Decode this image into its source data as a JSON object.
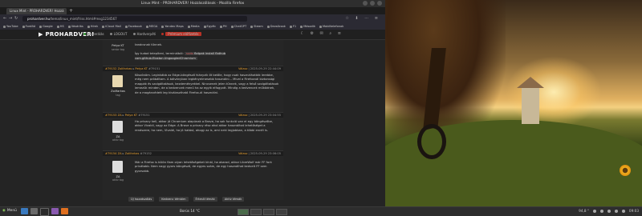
{
  "window": {
    "title": "Linux Mint - PROHARDVER! Hozzászólások - Mozilla Firefox"
  },
  "tab": {
    "label": "Linux Mint - PROHARDVER! Hozzá"
  },
  "url": {
    "prefix": "prohardver.hu",
    "path": "/tema/linux_mint/friss.html#msg1234567"
  },
  "bookmarks": [
    "YouTube",
    "Fordító",
    "Google",
    "HS",
    "Vásárlás",
    "Hírek",
    "iCloud Mail",
    "Facebook",
    "MEGA",
    "Yandex Maps",
    "Media",
    "Egyéb",
    "PH",
    "ChatGPT",
    "Steam",
    "Dezsőcsak",
    "F1",
    "Második",
    "Mobiltelefonok"
  ],
  "site": {
    "logo_prefix": "▶",
    "logo": "PROHARDVER!",
    "nav": [
      {
        "label": "Moderálás",
        "color": "#3a9a3a"
      },
      {
        "label": "LOGOUT",
        "color": "#888"
      },
      {
        "label": "Hardverpéti",
        "color": "#888"
      },
      {
        "label": "Prémium előfizetés",
        "color": "#b83227"
      }
    ]
  },
  "posts": [
    {
      "user": "Petya KT",
      "rank": "senior tag",
      "text1": "tanácsnak tűnnek.",
      "text2_pre": "Így tudod telepíteni, terminálból:",
      "code_pre": "sudo",
      "code_mid": "flatpak",
      "code_post": "install flathub com.github.Eloston.UngoogledChromium"
    },
    {
      "head_num": "#79152",
      "head_user": "Zolifarkas",
      "head_reply": "Petya KT",
      "head_ref": "#79151",
      "head_right_label": "Válasz",
      "head_date": "2025-09-29 22:44:09",
      "user": "Zolifarkas",
      "rank": "tag",
      "text": "Köszönöm. Leginkább az Edge-böngésző hiányzik őt belőle, hogy csak használhatták lerebbe, még nem próbáltam. A bálványban legkényelmesebb használni... Mivel a Firefoxnál biztonsági mappák és szolgáltatások, kezdeményekkel. Nincsenek jelen tűnnek, vagy a felső szolgáltatások lemezük minden, de a kedvencek menü ha az egyik elfogyott. Mindig a kedvencek működnek, de a magánvédett leg kiválasztható Firefox-ál használni."
    },
    {
      "head_num": "#79153",
      "head_user": "ZA",
      "head_reply": "Petya KT",
      "head_ref": "#79151",
      "head_right_label": "Válasz",
      "head_date": "2025-09-29 23:04:55",
      "user": "ZA",
      "rank": "aktív tag",
      "text": "Ha privacy kell, akkor jó Chromium alapúnak a Brave, ha sok funkció van el egy böngészőbe, akkor Vivaldi, vagy az Edge. A Brave a privacy rész ahol akkor használhat lehetőséget a rendszere, ha nem, Vivaldi, ha jó hatást, ahogy az is, ami neki legjobban, a többi ennél is."
    },
    {
      "head_num": "#79154",
      "head_user": "ZA",
      "head_reply": "Zolifarkas",
      "head_ref": "#79152",
      "head_right_label": "Válasz",
      "head_date": "2025-09-29 23:06:05",
      "user": "ZA",
      "rank": "aktív tag",
      "text": "Már a Firefox is külön fiam olyan lehetőségeket kínál, ha akarod, akkor LibreWolf már FF fork privátabb. Nem nagy gyors böngésző, de egyes szám, de egy használhat kedvelt FF sem gyorsabb."
    }
  ],
  "footer_actions": [
    "Új hozzászólás",
    "Kedvenc témáim",
    "Értesít témák",
    "Aktív témák"
  ],
  "taskbar": {
    "menu": "Menü",
    "weather": "Borús 14 °C",
    "battery": "94,8 °",
    "clock": "09:03"
  }
}
